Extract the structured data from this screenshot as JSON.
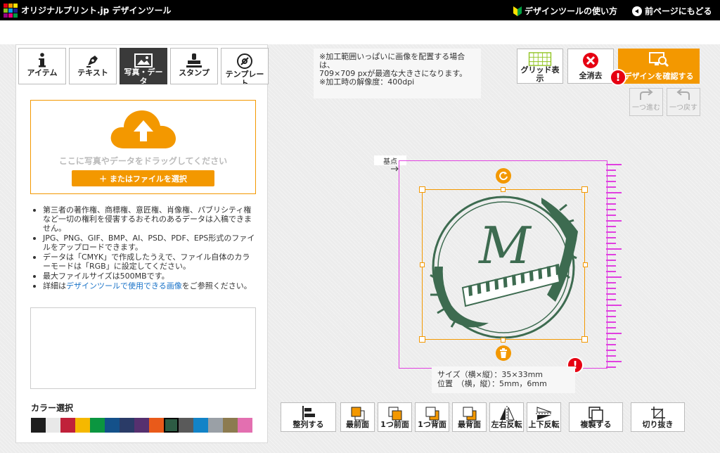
{
  "header": {
    "logo_text": "オリジナルプリント.jp デザインツール",
    "howto_label": "デザインツールの使い方",
    "back_label": "前ページにもどる"
  },
  "tabs": [
    {
      "label": "アイテム",
      "icon": "info-icon"
    },
    {
      "label": "テキスト",
      "icon": "pen-icon"
    },
    {
      "label": "写真・データ",
      "icon": "image-icon",
      "active": true
    },
    {
      "label": "スタンプ",
      "icon": "stamp-icon"
    },
    {
      "label": "テンプレート",
      "icon": "template-icon"
    }
  ],
  "upload": {
    "drop_text": "ここに写真やデータをドラッグしてください",
    "file_button": "＋ またはファイルを選択"
  },
  "notes": {
    "n1": "第三者の著作権、商標権、意匠権、肖像権、パブリシティ権など一切の権利を侵害するおそれのあるデータは入稿できません。",
    "n2": "JPG、PNG、GIF、BMP、AI、PSD、PDF、EPS形式のファイルをアップロードできます。",
    "n3": "データは「CMYK」で作成したうえで、ファイル自体のカラーモードは「RGB」に設定してください。",
    "n4": "最大ファイルサイズは500MBです。",
    "n5_pre": "詳細は",
    "n5_link": "デザインツールで使用できる画像",
    "n5_post": "をご参照ください。"
  },
  "color": {
    "title": "カラー選択",
    "swatches": [
      "#1e1e1e",
      "#e8e8e8",
      "#c0213a",
      "#f5b800",
      "#0b9640",
      "#14518a",
      "#2a3b67",
      "#56306f",
      "#e95a1a",
      "#2d5b44",
      "#5a5a5a",
      "#1283c7",
      "#9aa0a6",
      "#8c7b50",
      "#e36fb0"
    ],
    "selected_index": 9
  },
  "info_note": {
    "line1": "※加工範囲いっぱいに画像を配置する場合は、",
    "line2": "709×709 pxが最適な大きさになります。",
    "line3": "※加工時の解像度：400dpi"
  },
  "toolbar_top": {
    "grid_label": "グリッド表示",
    "clear_label": "全消去",
    "confirm_label": "デザインを確認する",
    "redo_label": "一つ進む",
    "undo_label": "一つ戻す"
  },
  "canvas": {
    "origin_label": "基点",
    "size_line": "サイズ（横×縦）：35×33mm",
    "pos_line": "位置　（横，縦）：5mm，6mm",
    "design_letter": "M"
  },
  "bottom_toolbar": [
    {
      "label": "整列する",
      "icon": "align-icon"
    },
    {
      "label": "最前面",
      "icon": "bring-front-icon"
    },
    {
      "label": "1つ前面",
      "icon": "forward-icon"
    },
    {
      "label": "1つ背面",
      "icon": "backward-icon"
    },
    {
      "label": "最背面",
      "icon": "send-back-icon"
    },
    {
      "label": "左右反転",
      "icon": "flip-h-icon"
    },
    {
      "label": "上下反転",
      "icon": "flip-v-icon"
    },
    {
      "label": "複製する",
      "icon": "duplicate-icon"
    },
    {
      "label": "切り抜き",
      "icon": "crop-icon"
    }
  ],
  "colors": {
    "accent": "#f39800",
    "alert": "#e60012",
    "print_area": "#e040e0",
    "design": "#3d6b50"
  }
}
